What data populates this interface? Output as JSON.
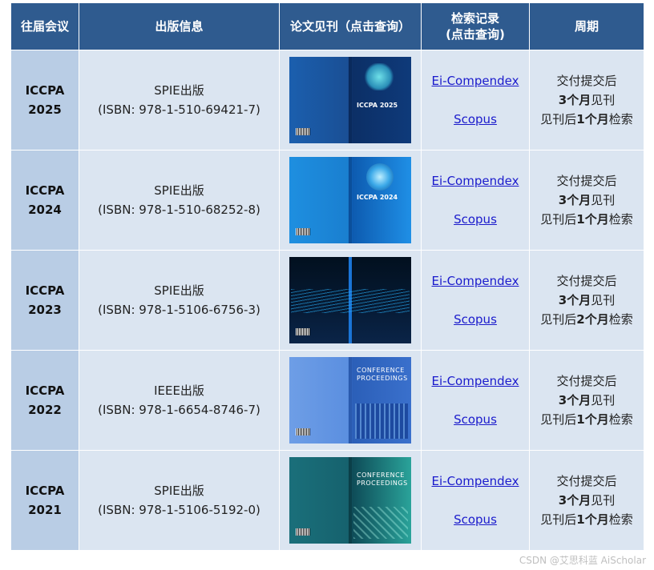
{
  "headers": {
    "conf": "往届会议",
    "pub": "出版信息",
    "proc": "论文见刊（点击查询）",
    "index_line1": "检索记录",
    "index_line2": "(点击查询)",
    "period": "周期"
  },
  "rows": [
    {
      "conf_name": "ICCPA",
      "conf_year": "2025",
      "publisher": "SPIE出版",
      "isbn": "(ISBN: 978-1-510-69421-7)",
      "cover_title": "ICCPA 2025",
      "ei": "Ei-Compendex",
      "scopus": "Scopus ",
      "p1": "交付提交后",
      "p2a": "3个月",
      "p2b": "见刊",
      "p3a": "见刊后",
      "p3b": "1个月",
      "p3c": "检索"
    },
    {
      "conf_name": "ICCPA",
      "conf_year": "2024",
      "publisher": "SPIE出版",
      "isbn": "(ISBN: 978-1-510-68252-8)",
      "cover_title": "ICCPA 2024",
      "ei": "Ei-Compendex",
      "scopus": "Scopus ",
      "p1": "交付提交后",
      "p2a": "3个月",
      "p2b": "见刊",
      "p3a": "见刊后",
      "p3b": "1个月",
      "p3c": "检索"
    },
    {
      "conf_name": "ICCPA",
      "conf_year": "2023",
      "publisher": "SPIE出版",
      "isbn": "(ISBN: 978-1-5106-6756-3)",
      "cover_title": "",
      "ei": "Ei-Compendex",
      "scopus": "Scopus ",
      "p1": "交付提交后",
      "p2a": "3个月",
      "p2b": "见刊",
      "p3a": "见刊后",
      "p3b": "2个月",
      "p3c": "检索"
    },
    {
      "conf_name": "ICCPA",
      "conf_year": "2022",
      "publisher": "IEEE出版",
      "isbn": "(ISBN: 978-1-6654-8746-7)",
      "cover_title": "CONFERENCE PROCEEDINGS",
      "ei": "Ei-Compendex",
      "scopus": "Scopus ",
      "p1": "交付提交后",
      "p2a": "3个月",
      "p2b": "见刊",
      "p3a": "见刊后",
      "p3b": "1个月",
      "p3c": "检索"
    },
    {
      "conf_name": "ICCPA",
      "conf_year": "2021",
      "publisher": "SPIE出版",
      "isbn": "(ISBN: 978-1-5106-5192-0)",
      "cover_title": "CONFERENCE PROCEEDINGS",
      "ei": "Ei-Compendex",
      "scopus": "Scopus ",
      "p1": "交付提交后",
      "p2a": "3个月",
      "p2b": "见刊",
      "p3a": "见刊后",
      "p3b": "1个月",
      "p3c": "检索"
    }
  ],
  "colors": {
    "header_bg": "#2f5b8f",
    "conf_bg": "#b9cde5",
    "cell_bg": "#dbe5f1",
    "link": "#1a1acc"
  },
  "watermark": "CSDN @艾思科蓝 AiScholar"
}
